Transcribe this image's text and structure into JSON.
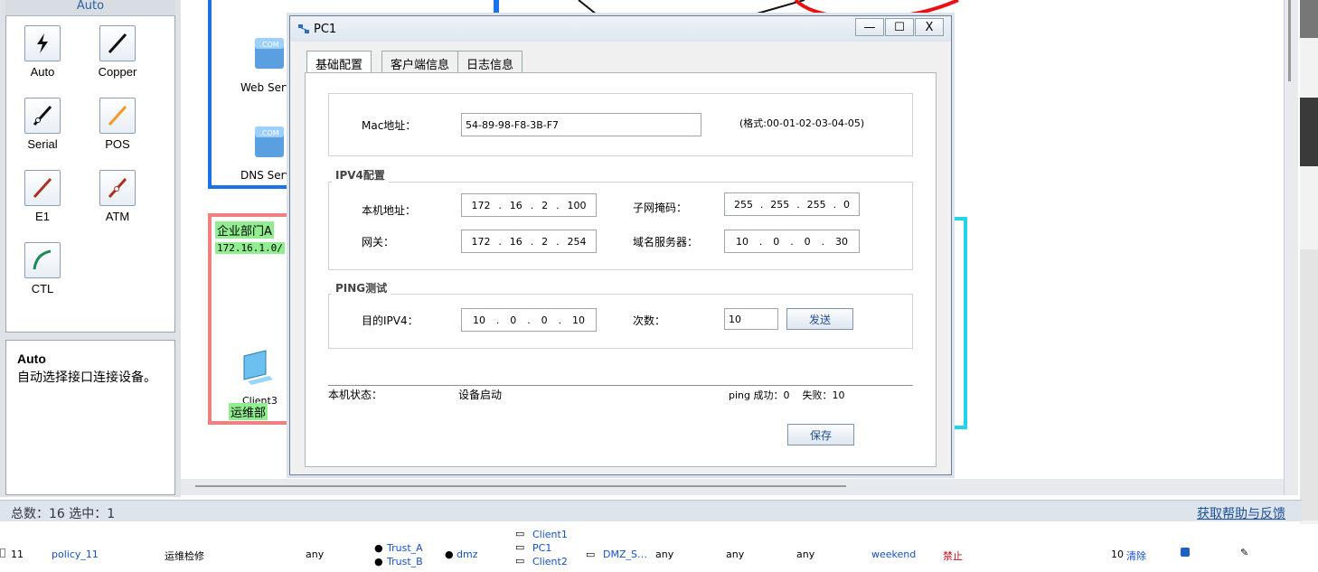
{
  "palette": {
    "header": "Auto",
    "items": [
      {
        "label": "Auto",
        "icon": "lightning-cable-icon"
      },
      {
        "label": "Copper",
        "icon": "copper-cable-icon"
      },
      {
        "label": "Serial",
        "icon": "serial-cable-icon"
      },
      {
        "label": "POS",
        "icon": "pos-cable-icon"
      },
      {
        "label": "E1",
        "icon": "e1-cable-icon"
      },
      {
        "label": "ATM",
        "icon": "atm-cable-icon"
      },
      {
        "label": "CTL",
        "icon": "ctl-cable-icon"
      }
    ],
    "desc_title": "Auto",
    "desc_text": "自动选择接口连接设备。"
  },
  "canvas": {
    "web_server": "Web Serv",
    "dns_server": "DNS Serv",
    "dept_a": "企业部门A",
    "subnet": "172.16.1.0/",
    "client3": "Client3",
    "ops": "运维部"
  },
  "status": {
    "count": "总数：16 选中：1",
    "help": "获取帮助与反馈"
  },
  "policy_row": {
    "id": "11",
    "name": "policy_11",
    "desc": "运维检修",
    "src_user": "any",
    "src_zone_1": "Trust_A",
    "src_zone_2": "Trust_B",
    "dst_zone": "dmz",
    "src_addr_1": "Client1",
    "src_addr_2": "PC1",
    "src_addr_3": "Client2",
    "dst_addr": "DMZ_S…",
    "service": "any",
    "app": "any",
    "user": "any",
    "time": "weekend",
    "action": "禁止",
    "hits": "10",
    "clear": "清除"
  },
  "dialog": {
    "title": "PC1",
    "tabs": [
      "基础配置",
      "客户端信息",
      "日志信息"
    ],
    "mac_label": "Mac地址：",
    "mac_value": "54-89-98-F8-3B-F7",
    "mac_hint": "(格式:00-01-02-03-04-05)",
    "ipv4_title": "IPV4配置",
    "ip_label": "本机地址：",
    "ip": [
      "172",
      "16",
      "2",
      "100"
    ],
    "mask_label": "子网掩码：",
    "mask": [
      "255",
      "255",
      "255",
      "0"
    ],
    "gw_label": "网关：",
    "gw": [
      "172",
      "16",
      "2",
      "254"
    ],
    "dns_label": "域名服务器：",
    "dns": [
      "10",
      "0",
      "0",
      "30"
    ],
    "ping_title": "PING测试",
    "dest_label": "目的IPV4：",
    "dest": [
      "10",
      "0",
      "0",
      "10"
    ],
    "count_label": "次数：",
    "count_value": "10",
    "send": "发送",
    "state_label": "本机状态：",
    "state_value": "设备启动",
    "ping_result": "ping 成功：0    失败：10",
    "save": "保存"
  },
  "colors": {
    "server_zone": "#1a73e8",
    "dept_zone": "#f08080",
    "ops_zone": "#22d4e8",
    "label_bg": "#90ee90"
  }
}
